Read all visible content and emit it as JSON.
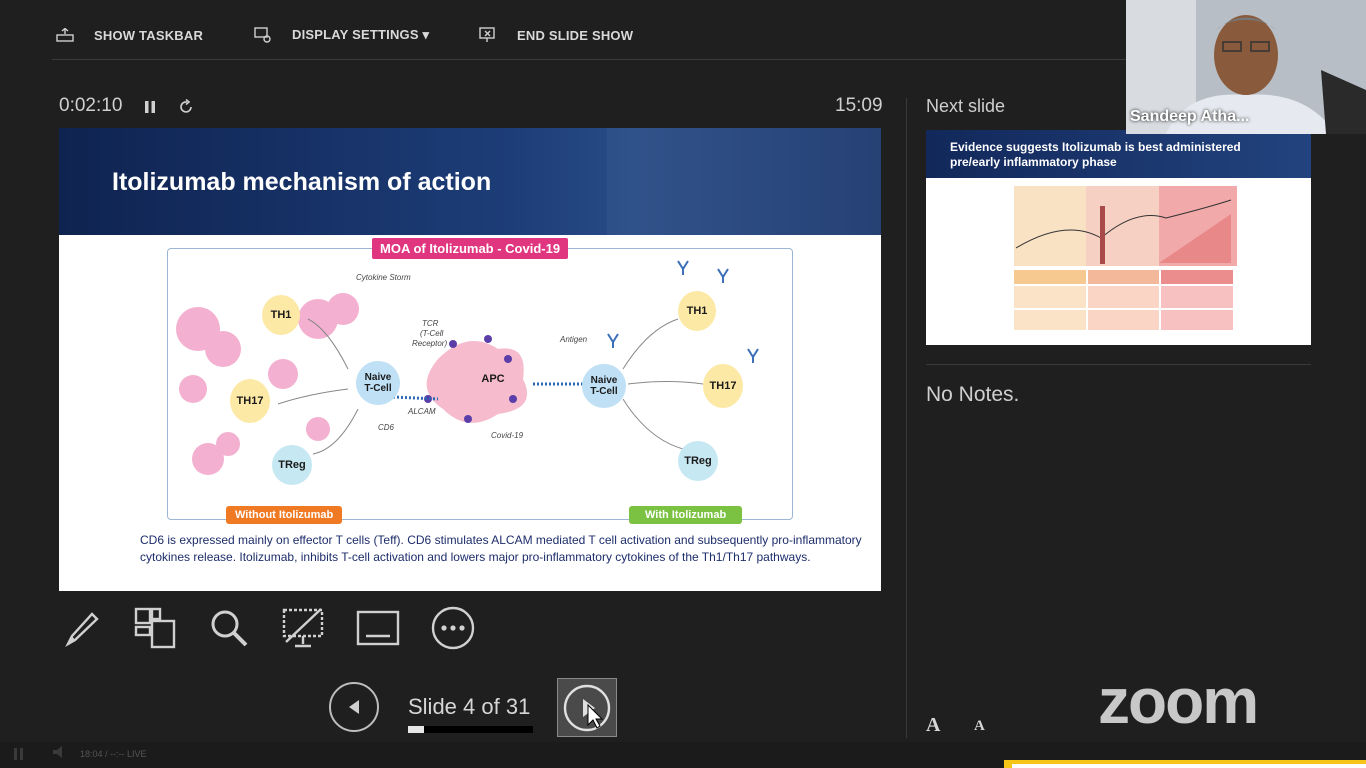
{
  "toolbar": {
    "show_taskbar": "SHOW TASKBAR",
    "display_settings": "DISPLAY SETTINGS ▾",
    "end_slide_show": "END SLIDE SHOW"
  },
  "presenter": {
    "timer": "0:02:10",
    "clock": "15:09"
  },
  "slide": {
    "title": "Itolizumab mechanism of action",
    "moa_tag": "MOA of Itolizumab - Covid-19",
    "labels": {
      "cytokine_storm": "Cytokine Storm",
      "tcr": "TCR",
      "tcr_sub1": "(T-Cell",
      "tcr_sub2": "Receptor)",
      "alcam": "ALCAM",
      "cd6": "CD6",
      "antigen": "Antigen",
      "covid": "Covid-19",
      "apc": "APC",
      "naive1": "Naive",
      "naive2": "T-Cell",
      "th1": "TH1",
      "th17": "TH17",
      "treg": "TReg"
    },
    "without_tag": "Without Itolizumab",
    "with_tag": "With Itolizumab",
    "caption": "CD6 is expressed mainly on effector T cells (Teff). CD6 stimulates ALCAM mediated T cell activation and subsequently pro-inflammatory cytokines release. Itolizumab, inhibits T-cell activation and lowers major pro-inflammatory cytokines of the Th1/Th17 pathways."
  },
  "navigation": {
    "counter": "Slide 4 of 31",
    "progress_fraction": 0.129
  },
  "next_slide": {
    "label": "Next slide",
    "title": "Evidence suggests Itolizumab is best administered pre/early inflammatory phase"
  },
  "notes": "No Notes.",
  "video": {
    "name": "Sandeep Atha..."
  },
  "brand": "zoom",
  "font_controls": {
    "larger": "A",
    "smaller": "A"
  },
  "status": {
    "text": "18:04 / --:-- LIVE"
  }
}
